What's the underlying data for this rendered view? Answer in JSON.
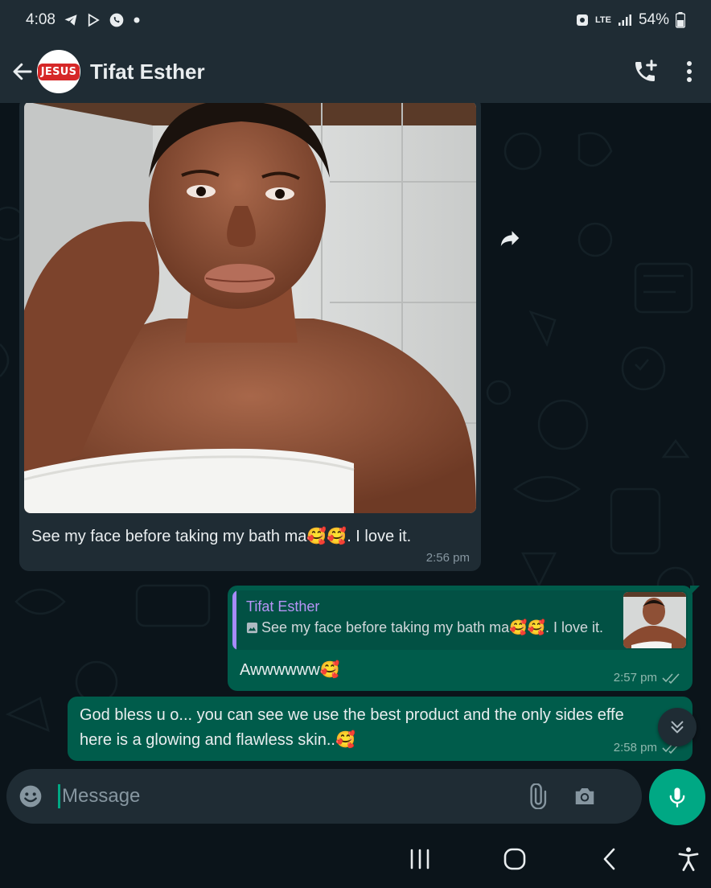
{
  "status_bar": {
    "time": "4:08",
    "network": "LTE",
    "battery": "54%",
    "icons": [
      "telegram-icon",
      "play-icon",
      "whatsapp-icon",
      "dot-icon",
      "shield-icon",
      "signal-icon",
      "battery-icon"
    ]
  },
  "header": {
    "avatar_text": "JESUS",
    "contact_name": "Tifat Esther",
    "icons": [
      "back-arrow-icon",
      "add-call-icon",
      "more-vert-icon"
    ]
  },
  "messages": [
    {
      "direction": "incoming",
      "type": "image",
      "caption": "See my face before taking my bath ma🥰🥰. I love it.",
      "time": "2:56 pm"
    },
    {
      "direction": "outgoing",
      "quote": {
        "name": "Tifat Esther",
        "text": "See my face before taking my bath ma🥰🥰. I love it."
      },
      "text": "Awwwwww🥰",
      "time": "2:57 pm",
      "status": "read"
    },
    {
      "direction": "outgoing",
      "text_line1": "God bless u o... you can see we use the best product and the only sides effe",
      "text_line2": "here is a glowing and flawless skin..🥰",
      "time": "2:58 pm",
      "status": "read"
    }
  ],
  "input": {
    "placeholder": "Message"
  },
  "colors": {
    "header_bg": "#1f2c34",
    "chat_bg": "#0b141a",
    "incoming_bubble": "#1f2c34",
    "outgoing_bubble": "#005c4b",
    "accent": "#00a884",
    "quote_name": "#b794f6"
  }
}
